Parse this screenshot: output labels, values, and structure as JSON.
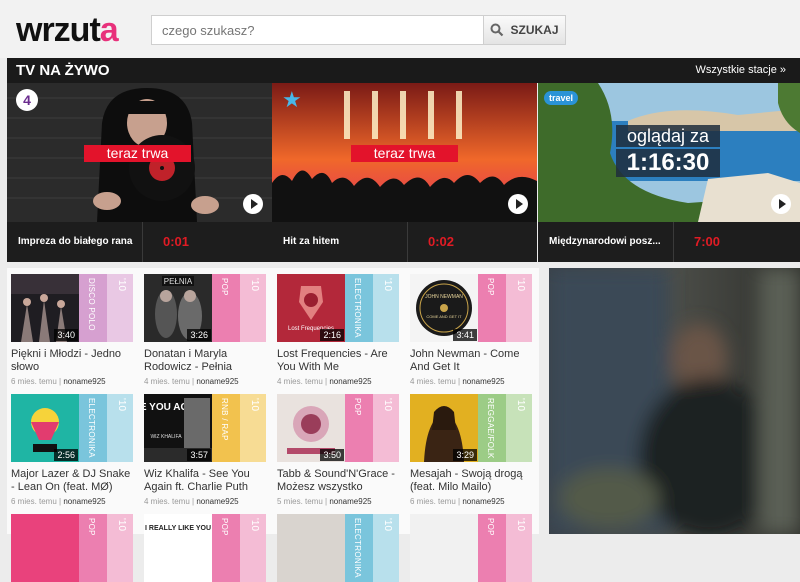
{
  "header": {
    "logo_main": "wrzut",
    "logo_accent": "a",
    "search_placeholder": "czego szukasz?",
    "search_button": "SZUKAJ"
  },
  "tv": {
    "title": "TV NA ŻYWO",
    "all_stations": "Wszystkie stacje »",
    "channels": [
      {
        "badge": "4",
        "status": "teraz trwa",
        "name": "Impreza do białego rana",
        "time": "0:01"
      },
      {
        "badge": "★",
        "status": "teraz trwa",
        "name": "Hit za hitem",
        "time": "0:02"
      },
      {
        "badge": "travel",
        "status_line1": "oglądaj za",
        "status_line2": "1:16:30",
        "name": "Międzynarodowi posz...",
        "time": "7:00"
      }
    ]
  },
  "clips": [
    {
      "title": "Piękni i Młodzi - Jedno słowo",
      "age": "6 mies. temu",
      "user": "noname925",
      "duration": "3:40",
      "genre": "DISCO POLO",
      "year": "'10",
      "genre_color": "#d6a0d0",
      "year_color": "#e9c8e4"
    },
    {
      "title": "Donatan i Maryla Rodowicz - Pełnia",
      "age": "4 mies. temu",
      "user": "noname925",
      "duration": "3:26",
      "genre": "POP",
      "year": "'10",
      "genre_color": "#ec7fb0",
      "year_color": "#f4bcd5"
    },
    {
      "title": "Lost Frequencies - Are You With Me",
      "age": "4 mies. temu",
      "user": "noname925",
      "duration": "2:16",
      "genre": "ELECTRONIKA",
      "year": "'10",
      "genre_color": "#7ac5dc",
      "year_color": "#b8e0ec"
    },
    {
      "title": "John Newman - Come And Get It",
      "age": "4 mies. temu",
      "user": "noname925",
      "duration": "3:41",
      "genre": "POP",
      "year": "'10",
      "genre_color": "#ec7fb0",
      "year_color": "#f4bcd5"
    },
    {
      "title": "Major Lazer & DJ Snake - Lean On (feat. MØ)",
      "age": "6 mies. temu",
      "user": "noname925",
      "duration": "2:56",
      "genre": "ELECTRONIKA",
      "year": "'10",
      "genre_color": "#7ac5dc",
      "year_color": "#b8e0ec"
    },
    {
      "title": "Wiz Khalifa - See You Again ft. Charlie Puth",
      "age": "4 mies. temu",
      "user": "noname925",
      "duration": "3:57",
      "genre": "RNB / RAP",
      "year": "'10",
      "genre_color": "#f2c24e",
      "year_color": "#f7dc94"
    },
    {
      "title": "Tabb & Sound'N'Grace - Możesz wszystko",
      "age": "5 mies. temu",
      "user": "noname925",
      "duration": "3:50",
      "genre": "POP",
      "year": "'10",
      "genre_color": "#ec7fb0",
      "year_color": "#f4bcd5"
    },
    {
      "title": "Mesajah - Swoją drogą (feat. Milo Mailo)",
      "age": "6 mies. temu",
      "user": "noname925",
      "duration": "3:29",
      "genre": "REGGAE/FOLK",
      "year": "'10",
      "genre_color": "#9ccc86",
      "year_color": "#c7e2b9"
    },
    {
      "title": "",
      "age": "",
      "user": "",
      "duration": "",
      "genre": "POP",
      "year": "'10",
      "genre_color": "#ec7fb0",
      "year_color": "#f4bcd5"
    },
    {
      "title": "",
      "age": "",
      "user": "",
      "duration": "",
      "genre": "POP",
      "year": "'10",
      "genre_color": "#ec7fb0",
      "year_color": "#f4bcd5"
    },
    {
      "title": "",
      "age": "",
      "user": "",
      "duration": "",
      "genre": "ELECTRONIKA",
      "year": "'10",
      "genre_color": "#7ac5dc",
      "year_color": "#b8e0ec"
    },
    {
      "title": "",
      "age": "",
      "user": "",
      "duration": "",
      "genre": "POP",
      "year": "'10",
      "genre_color": "#ec7fb0",
      "year_color": "#f4bcd5"
    }
  ],
  "clip_row_2_thumb_text": {
    "wiz": "SEE YOU AGAIN",
    "wiz_sub": "WIZ KHALIFA",
    "newman": "JOHN NEWMAN",
    "newman_sub": "COME AND GET IT",
    "pelnia": "PEŁNIA",
    "lost": "Lost Frequencies",
    "bottom_1": "I REALLY LIKE YOU"
  },
  "icons": {
    "search": "search-icon",
    "play": "play-icon"
  }
}
